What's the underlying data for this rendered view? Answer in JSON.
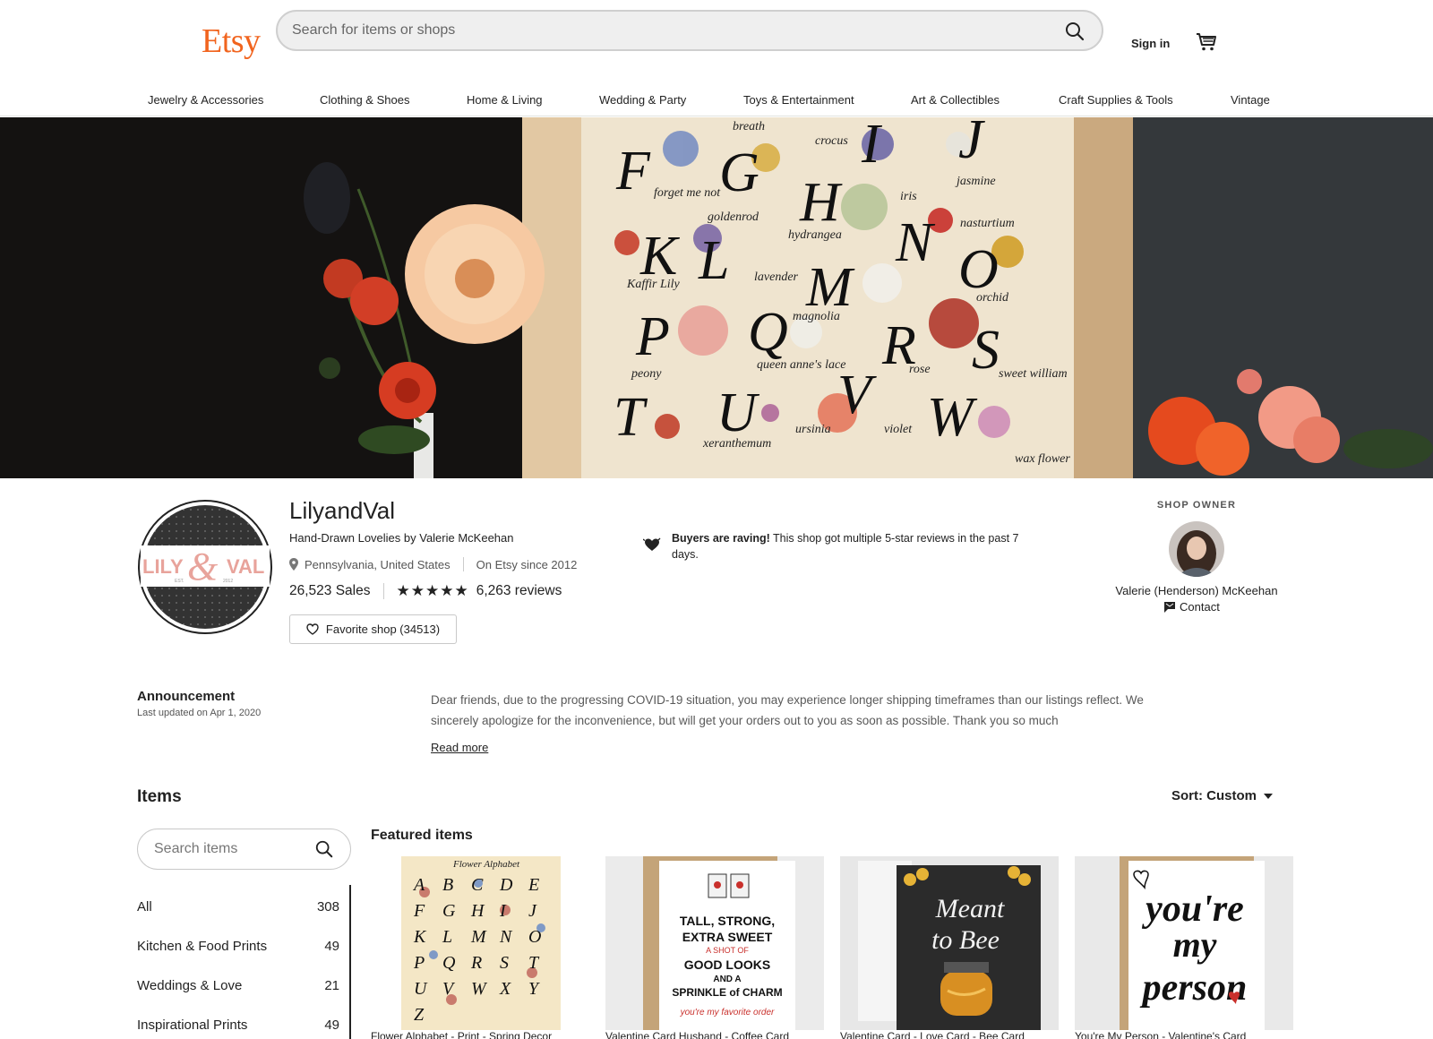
{
  "header": {
    "logo": "Etsy",
    "search_placeholder": "Search for items or shops",
    "sign_in": "Sign in",
    "categories": [
      "Jewelry & Accessories",
      "Clothing & Shoes",
      "Home & Living",
      "Wedding & Party",
      "Toys & Entertainment",
      "Art & Collectibles",
      "Craft Supplies & Tools",
      "Vintage"
    ]
  },
  "banner": {
    "letters": [
      "F",
      "G",
      "H",
      "I",
      "J",
      "K",
      "L",
      "M",
      "N",
      "O",
      "P",
      "Q",
      "R",
      "S",
      "T",
      "U",
      "V",
      "W"
    ],
    "flower_words": [
      "forget me not",
      "goldenrod",
      "hydrangea",
      "iris",
      "jasmine",
      "nasturtium",
      "Kaffir Lily",
      "lavender",
      "magnolia",
      "orchid",
      "peony",
      "queen anne's lace",
      "rose",
      "sweet william",
      "xeranthemum",
      "ursinia",
      "violet",
      "wax flower",
      "crocus",
      "breath"
    ]
  },
  "shop": {
    "logo_text_left": "LILY",
    "logo_ampersand": "&",
    "logo_text_right": "VAL",
    "logo_est": "EST.",
    "logo_year": "2012",
    "name": "LilyandVal",
    "tagline": "Hand-Drawn Lovelies by Valerie McKeehan",
    "location": "Pennsylvania, United States",
    "since": "On Etsy since 2012",
    "sales": "26,523 Sales",
    "stars": "★★★★★",
    "rating": 5,
    "reviews": "6,263 reviews",
    "favorite_button": "Favorite shop (34513)",
    "raving_bold": "Buyers are raving!",
    "raving_text": " This shop got multiple 5-star reviews in the past 7 days."
  },
  "owner": {
    "label": "SHOP OWNER",
    "name": "Valerie (Henderson) McKeehan",
    "contact": "Contact"
  },
  "announcement": {
    "title": "Announcement",
    "updated": "Last updated on Apr 1, 2020",
    "text": "Dear friends, due to the progressing COVID-19 situation, you may experience longer shipping timeframes than our listings reflect. We sincerely apologize for the inconvenience, but will get your orders out to you as soon as possible. Thank you so much",
    "read_more": "Read more"
  },
  "items": {
    "title": "Items",
    "sort": "Sort: Custom",
    "search_placeholder": "Search items",
    "featured_title": "Featured items",
    "sections": [
      {
        "label": "All",
        "count": "308"
      },
      {
        "label": "Kitchen & Food Prints",
        "count": "49"
      },
      {
        "label": "Weddings & Love",
        "count": "21"
      },
      {
        "label": "Inspirational Prints",
        "count": "49"
      }
    ],
    "featured": [
      {
        "title": "Flower Alphabet - Print - Spring Decor",
        "art_heading": "Flower Alphabet",
        "art_letters": [
          "A",
          "B",
          "C",
          "D",
          "E",
          "F",
          "G",
          "H",
          "I",
          "J",
          "K",
          "L",
          "M",
          "N",
          "O",
          "P",
          "Q",
          "R",
          "S",
          "T",
          "U",
          "V",
          "W",
          "X",
          "Y",
          "Z"
        ]
      },
      {
        "title": "Valentine Card Husband - Coffee Card",
        "art_lines": [
          "TALL, STRONG,",
          "EXTRA SWEET",
          "A SHOT OF",
          "GOOD LOOKS",
          "AND A",
          "SPRINKLE of CHARM",
          "you're my favorite order"
        ]
      },
      {
        "title": "Valentine Card - Love Card - Bee Card",
        "art_lines": [
          "Meant",
          "to Bee"
        ]
      },
      {
        "title": "You're My Person - Valentine's Card",
        "art_lines": [
          "you're",
          "my",
          "person"
        ]
      }
    ]
  },
  "colors": {
    "brand": "#F1641E",
    "text": "#222222",
    "muted": "#595959",
    "logo_pink": "#E8A39B",
    "chalkboard": "#2B2B2B"
  }
}
